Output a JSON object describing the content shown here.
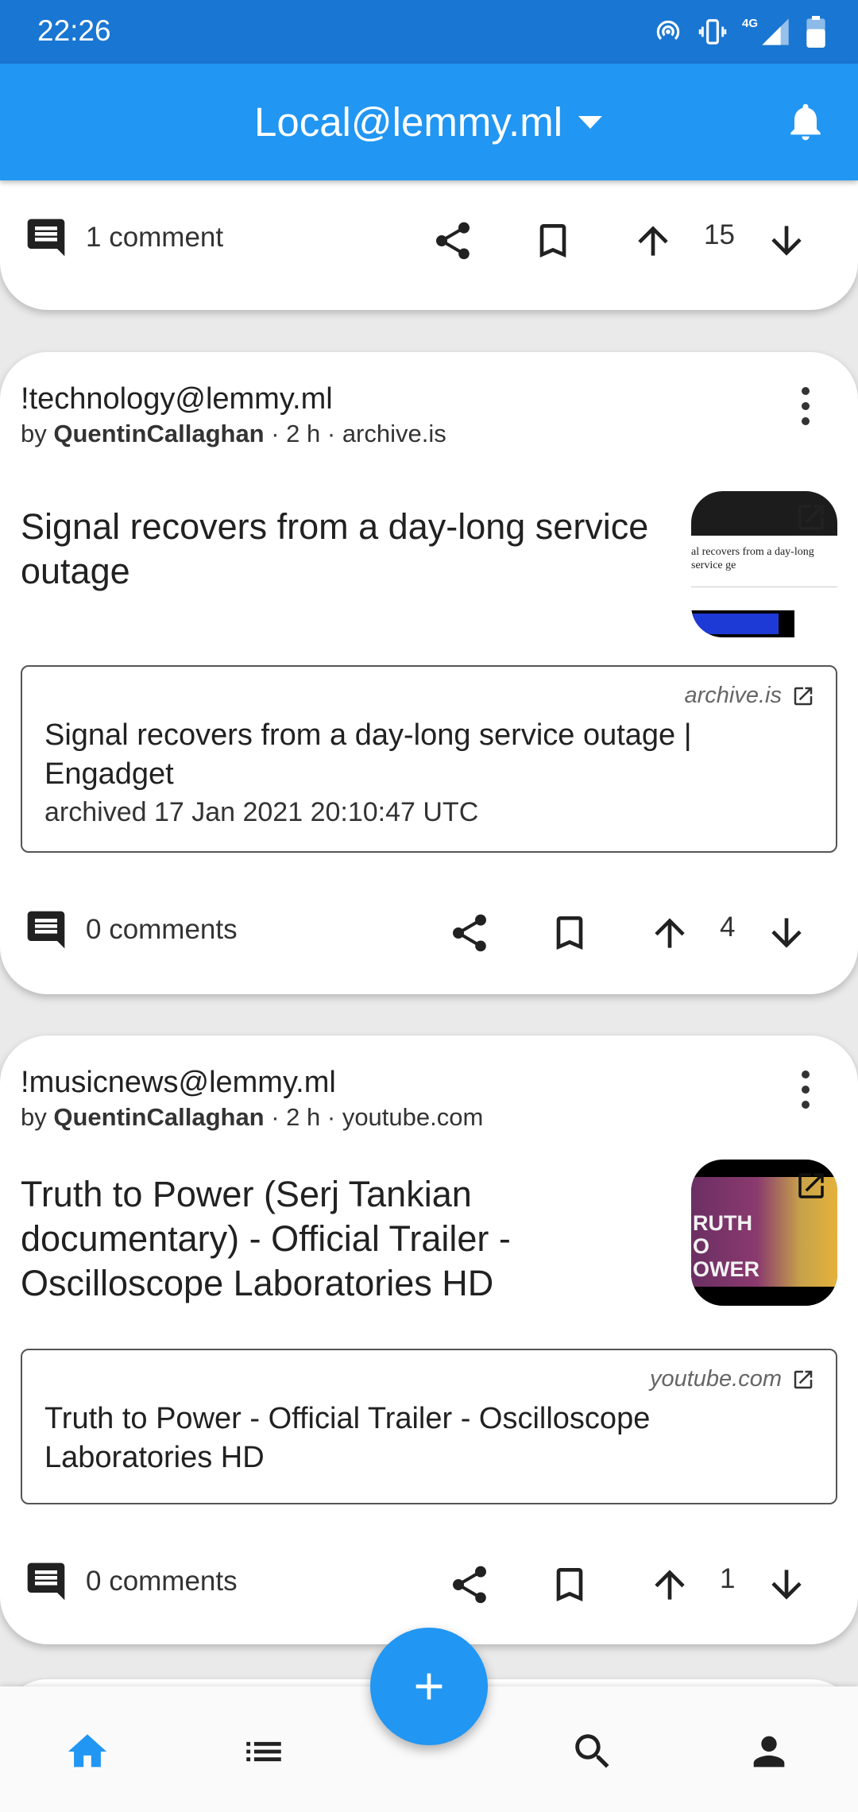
{
  "status_bar": {
    "time": "22:26",
    "network": "4G"
  },
  "app_bar": {
    "instance_title": "Local@lemmy.ml"
  },
  "posts": [
    {
      "comments_label": "1 comment",
      "score": "15"
    },
    {
      "community_prefix": "!",
      "community": "technology@lemmy.ml",
      "by_label": "by",
      "author": "QuentinCallaghan",
      "meta_rest": " · 2 h · archive.is",
      "title": "Signal recovers from a day-long service outage",
      "link_domain": "archive.is",
      "link_title": "Signal recovers from a day-long service outage | Engadget",
      "link_subtitle": "archived 17 Jan 2021 20:10:47 UTC",
      "thumb_caption": "al recovers from a day-long service ge",
      "comments_label": "0 comments",
      "score": "4"
    },
    {
      "community_prefix": "!",
      "community": "musicnews@lemmy.ml",
      "by_label": "by",
      "author": "QuentinCallaghan",
      "meta_rest": " · 2 h · youtube.com",
      "title": "Truth to Power (Serj Tankian documentary) - Official Trailer - Oscilloscope Laboratories HD",
      "link_domain": "youtube.com",
      "link_title": "Truth to Power - Official Trailer - Oscilloscope Laboratories HD",
      "thumb_text": "RUTH\nO\nOWER",
      "comments_label": "0 comments",
      "score": "1"
    }
  ],
  "colors": {
    "primary": "#2196f3",
    "status_bar": "#1976d2",
    "nav_active": "#2196f3",
    "icon": "#212121"
  },
  "icons": {
    "comments": "comment-icon",
    "share": "share-icon",
    "save": "bookmark-icon",
    "upvote": "arrow-up-icon",
    "downvote": "arrow-down-icon",
    "external": "open-in-new-icon",
    "more": "more-vert-icon",
    "fab": "plus-icon",
    "nav": [
      "home-icon",
      "list-icon",
      "search-icon",
      "person-icon"
    ]
  }
}
